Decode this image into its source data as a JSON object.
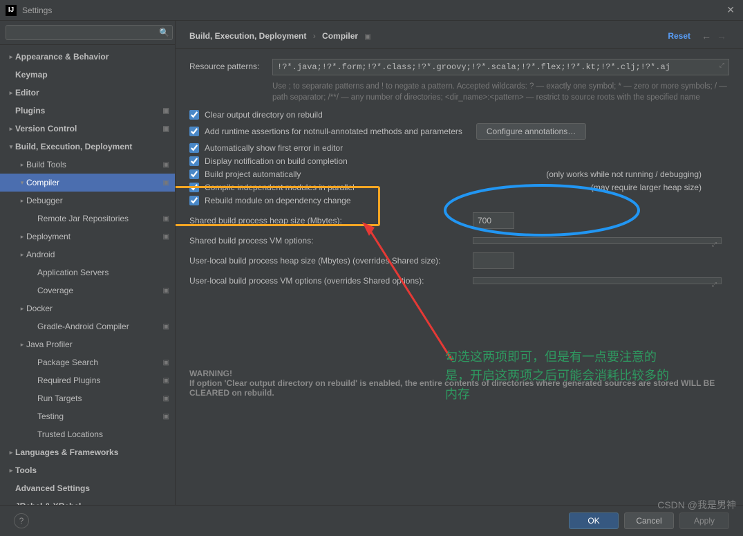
{
  "window": {
    "title": "Settings"
  },
  "search": {
    "placeholder": ""
  },
  "sidebar": {
    "items": [
      {
        "label": "Appearance & Behavior",
        "bold": true,
        "chev": ">",
        "indent": 0,
        "badge": ""
      },
      {
        "label": "Keymap",
        "bold": true,
        "chev": "",
        "indent": 0,
        "badge": ""
      },
      {
        "label": "Editor",
        "bold": true,
        "chev": ">",
        "indent": 0,
        "badge": ""
      },
      {
        "label": "Plugins",
        "bold": true,
        "chev": "",
        "indent": 0,
        "badge": "▣"
      },
      {
        "label": "Version Control",
        "bold": true,
        "chev": ">",
        "indent": 0,
        "badge": "▣"
      },
      {
        "label": "Build, Execution, Deployment",
        "bold": true,
        "chev": "v",
        "indent": 0,
        "badge": ""
      },
      {
        "label": "Build Tools",
        "bold": false,
        "chev": ">",
        "indent": 1,
        "badge": "▣"
      },
      {
        "label": "Compiler",
        "bold": false,
        "chev": "v",
        "indent": 1,
        "badge": "▣",
        "selected": true
      },
      {
        "label": "Debugger",
        "bold": false,
        "chev": ">",
        "indent": 1,
        "badge": ""
      },
      {
        "label": "Remote Jar Repositories",
        "bold": false,
        "chev": "",
        "indent": 2,
        "badge": "▣"
      },
      {
        "label": "Deployment",
        "bold": false,
        "chev": ">",
        "indent": 1,
        "badge": "▣"
      },
      {
        "label": "Android",
        "bold": false,
        "chev": ">",
        "indent": 1,
        "badge": ""
      },
      {
        "label": "Application Servers",
        "bold": false,
        "chev": "",
        "indent": 2,
        "badge": ""
      },
      {
        "label": "Coverage",
        "bold": false,
        "chev": "",
        "indent": 2,
        "badge": "▣"
      },
      {
        "label": "Docker",
        "bold": false,
        "chev": ">",
        "indent": 1,
        "badge": ""
      },
      {
        "label": "Gradle-Android Compiler",
        "bold": false,
        "chev": "",
        "indent": 2,
        "badge": "▣"
      },
      {
        "label": "Java Profiler",
        "bold": false,
        "chev": ">",
        "indent": 1,
        "badge": ""
      },
      {
        "label": "Package Search",
        "bold": false,
        "chev": "",
        "indent": 2,
        "badge": "▣"
      },
      {
        "label": "Required Plugins",
        "bold": false,
        "chev": "",
        "indent": 2,
        "badge": "▣"
      },
      {
        "label": "Run Targets",
        "bold": false,
        "chev": "",
        "indent": 2,
        "badge": "▣"
      },
      {
        "label": "Testing",
        "bold": false,
        "chev": "",
        "indent": 2,
        "badge": "▣"
      },
      {
        "label": "Trusted Locations",
        "bold": false,
        "chev": "",
        "indent": 2,
        "badge": ""
      },
      {
        "label": "Languages & Frameworks",
        "bold": true,
        "chev": ">",
        "indent": 0,
        "badge": ""
      },
      {
        "label": "Tools",
        "bold": true,
        "chev": ">",
        "indent": 0,
        "badge": ""
      },
      {
        "label": "Advanced Settings",
        "bold": true,
        "chev": "",
        "indent": 0,
        "badge": ""
      },
      {
        "label": "JRebel & XRebel",
        "bold": true,
        "chev": ">",
        "indent": 0,
        "badge": ""
      }
    ]
  },
  "breadcrumb": {
    "part1": "Build, Execution, Deployment",
    "part2": "Compiler",
    "badge": "▣",
    "reset": "Reset"
  },
  "form": {
    "resource_label": "Resource patterns:",
    "resource_value": "!?*.java;!?*.form;!?*.class;!?*.groovy;!?*.scala;!?*.flex;!?*.kt;!?*.clj;!?*.aj",
    "help": "Use ; to separate patterns and ! to negate a pattern. Accepted wildcards: ? — exactly one symbol; * — zero or more symbols; / — path separator; /**/ — any number of directories;  <dir_name>:<pattern> — restrict to source roots with the specified name",
    "cb_clear": "Clear output directory on rebuild",
    "cb_runtime": "Add runtime assertions for notnull-annotated methods and parameters",
    "btn_configure": "Configure annotations…",
    "cb_autofirst": "Automatically show first error in editor",
    "cb_notify": "Display notification on build completion",
    "cb_buildauto": "Build project automatically",
    "cb_buildauto_note": "(only works while not running / debugging)",
    "cb_parallel": "Compile independent modules in parallel",
    "cb_parallel_note": "(may require larger heap size)",
    "cb_rebuild": "Rebuild module on dependency change",
    "f_heap_label": "Shared build process heap size (Mbytes):",
    "f_heap_value": "700",
    "f_vm_label": "Shared build process VM options:",
    "f_vm_value": "",
    "f_userheap_label": "User-local build process heap size (Mbytes) (overrides Shared size):",
    "f_userheap_value": "",
    "f_uservm_label": "User-local build process VM options (overrides Shared options):",
    "f_uservm_value": "",
    "warning_title": "WARNING!",
    "warning_text": "If option 'Clear output directory on rebuild' is enabled, the entire contents of directories where generated sources are stored WILL BE CLEARED on rebuild."
  },
  "annotation": {
    "text": "勾选这两项即可，但是有一点要注意的是，开启这两项之后可能会消耗比较多的内存"
  },
  "buttons": {
    "ok": "OK",
    "cancel": "Cancel",
    "apply": "Apply"
  },
  "watermark": "CSDN @我是男神"
}
